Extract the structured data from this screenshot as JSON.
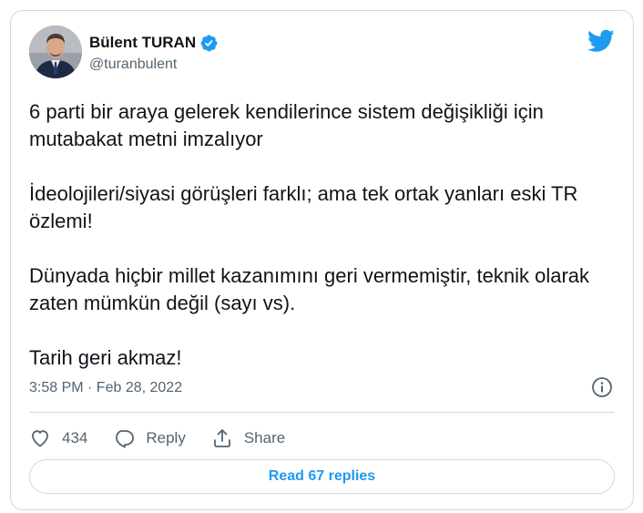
{
  "author": {
    "display_name": "Bülent TURAN",
    "handle": "@turanbulent",
    "verified": true
  },
  "tweet": {
    "paragraphs": [
      "6 parti bir araya gelerek kendilerince sistem değişikliği için mutabakat metni imzalıyor",
      "İdeolojileri/siyasi görüşleri farklı; ama tek ortak yanları eski TR özlemi!",
      "Dünyada hiçbir millet kazanımını geri vermemiştir, teknik olarak zaten mümkün değil (sayı vs).",
      "Tarih geri akmaz!"
    ],
    "timestamp": "3:58 PM · Feb 28, 2022"
  },
  "actions": {
    "like_count": "434",
    "reply_label": "Reply",
    "share_label": "Share"
  },
  "read_replies_label": "Read 67 replies",
  "icons": {
    "brand": "twitter-bird-icon",
    "verified": "verified-badge-icon",
    "info": "info-icon",
    "like": "heart-icon",
    "reply": "reply-bubble-icon",
    "share": "share-icon"
  },
  "colors": {
    "brand": "#1d9bf0",
    "text": "#0f1419",
    "muted": "#536471",
    "border": "#cfd9de"
  }
}
